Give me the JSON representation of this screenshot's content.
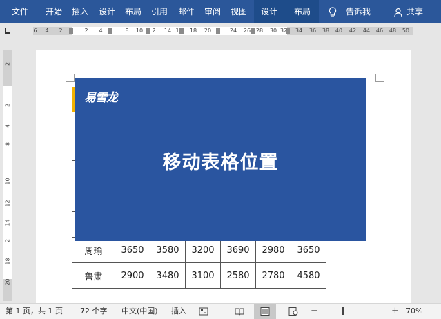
{
  "ribbon": {
    "tabs": [
      "文件",
      "开始",
      "插入",
      "设计",
      "布局",
      "引用",
      "邮件",
      "审阅",
      "视图"
    ],
    "context_tabs": [
      "设计",
      "布局"
    ],
    "tell_me": "告诉我",
    "share": "共享",
    "icons": {
      "tell_me": "lightbulb-icon",
      "share": "person-add-icon"
    },
    "colors": {
      "ribbon_bg": "#2b579a",
      "context_bg": "#1e4c8a"
    }
  },
  "ruler": {
    "horizontal_ticks": [
      "6",
      "4",
      "2",
      "2",
      "4",
      "8",
      "10",
      "2",
      "14",
      "1",
      "18",
      "20",
      "24",
      "26",
      "28",
      "30",
      "32",
      "34",
      "36",
      "38",
      "40",
      "42",
      "44",
      "46",
      "48",
      "50"
    ],
    "vertical_ticks": [
      "2",
      "2",
      "4",
      "8",
      "10",
      "12",
      "14",
      "2",
      "18",
      "20"
    ]
  },
  "overlay": {
    "logo": "易雪龙",
    "headline": "移动表格位置",
    "color": "#2a55a0"
  },
  "table": {
    "rows": [
      [
        "",
        "",
        "",
        "",
        "",
        "",
        ""
      ],
      [
        "",
        "",
        "",
        "",
        "",
        "",
        ""
      ],
      [
        "",
        "",
        "",
        "",
        "",
        "",
        ""
      ],
      [
        "",
        "",
        "",
        "",
        "",
        "",
        ""
      ],
      [
        "",
        "",
        "",
        "",
        "",
        "",
        ""
      ],
      [
        "",
        "",
        "",
        "",
        "",
        "",
        ""
      ],
      [
        "周瑜",
        "3650",
        "3580",
        "3200",
        "3690",
        "2980",
        "3650"
      ],
      [
        "鲁肃",
        "2900",
        "3480",
        "3100",
        "2580",
        "2780",
        "4580"
      ]
    ]
  },
  "status": {
    "page": "第 1 页，共 1 页",
    "words": "72 个字",
    "language": "中文(中国)",
    "mode": "插入",
    "zoom_minus": "−",
    "zoom_plus": "+",
    "zoom": "70%"
  }
}
